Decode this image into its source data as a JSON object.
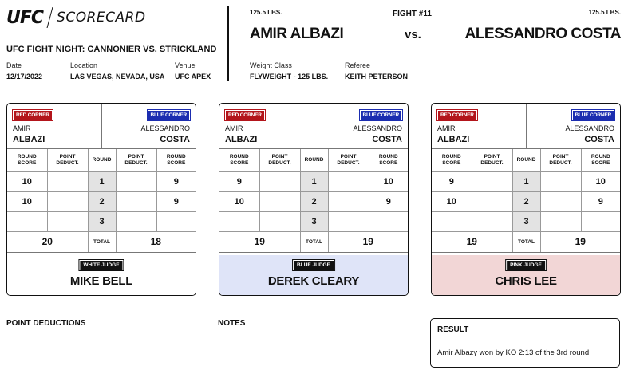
{
  "header": {
    "logo_text": "UFC",
    "logo_subtitle": "SCORECARD",
    "event_name": "UFC FIGHT NIGHT: CANNONIER VS. STRICKLAND",
    "date_label": "Date",
    "date_value": "12/17/2022",
    "location_label": "Location",
    "location_value": "LAS VEGAS, NEVADA, USA",
    "venue_label": "Venue",
    "venue_value": "UFC APEX",
    "weight_class_label": "Weight Class",
    "weight_class_value": "FLYWEIGHT - 125 LBS.",
    "referee_label": "Referee",
    "referee_value": "KEITH PETERSON"
  },
  "fight": {
    "number": "FIGHT #11",
    "vs": "vs.",
    "red_weight": "125.5 LBS.",
    "red_name": "AMIR ALBAZI",
    "blue_weight": "125.5 LBS.",
    "blue_name": "ALESSANDRO COSTA"
  },
  "card_labels": {
    "red_corner": "RED CORNER",
    "blue_corner": "BLUE CORNER",
    "red_first": "AMIR",
    "red_last": "ALBAZI",
    "blue_first": "ALESSANDRO",
    "blue_last": "COSTA",
    "round_score_1": "ROUND",
    "round_score_2": "SCORE",
    "point_deduct_1": "POINT",
    "point_deduct_2": "DEDUCT.",
    "round": "ROUND",
    "total": "TOTAL",
    "round_numbers": [
      "1",
      "2",
      "3"
    ]
  },
  "judges": [
    {
      "badge": "WHITE JUDGE",
      "name": "MIKE BELL",
      "panel_color": "#ffffff",
      "red_scores": [
        "10",
        "10",
        ""
      ],
      "red_deducts": [
        "",
        "",
        ""
      ],
      "blue_deducts": [
        "",
        "",
        ""
      ],
      "blue_scores": [
        "9",
        "9",
        ""
      ],
      "red_total": "20",
      "blue_total": "18"
    },
    {
      "badge": "BLUE JUDGE",
      "name": "DEREK CLEARY",
      "panel_color": "#dfe4f8",
      "red_scores": [
        "9",
        "10",
        ""
      ],
      "red_deducts": [
        "",
        "",
        ""
      ],
      "blue_deducts": [
        "",
        "",
        ""
      ],
      "blue_scores": [
        "10",
        "9",
        ""
      ],
      "red_total": "19",
      "blue_total": "19"
    },
    {
      "badge": "PINK JUDGE",
      "name": "CHRIS LEE",
      "panel_color": "#f2d6d6",
      "red_scores": [
        "9",
        "10",
        ""
      ],
      "red_deducts": [
        "",
        "",
        ""
      ],
      "blue_deducts": [
        "",
        "",
        ""
      ],
      "blue_scores": [
        "10",
        "9",
        ""
      ],
      "red_total": "19",
      "blue_total": "19"
    }
  ],
  "sections": {
    "point_deductions": "POINT DEDUCTIONS",
    "notes": "NOTES"
  },
  "result": {
    "title": "RESULT",
    "text": "Amir Albazy won by KO 2:13 of the 3rd round"
  },
  "colors": {
    "red_corner": "#b3151b",
    "blue_corner": "#1b2db0",
    "round_cell": "#e3e3e3"
  }
}
